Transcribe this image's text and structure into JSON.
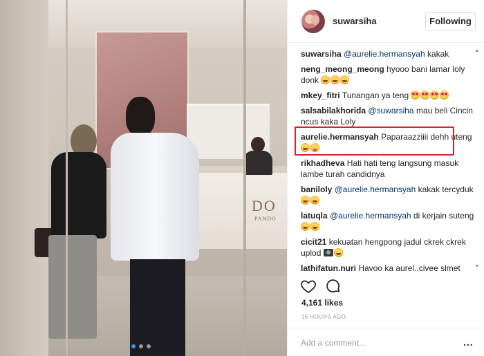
{
  "post": {
    "username": "suwarsiha",
    "follow_label": "Following",
    "likes": "4,161 likes",
    "timestamp": "16 HOURS AGO",
    "add_comment_placeholder": "Add a comment...",
    "more_label": "...",
    "carousel": {
      "count": 3,
      "active": 1
    },
    "store_sign": "DO",
    "store_sign_small": "PANDO"
  },
  "comments": [
    {
      "user": "suwarsiha",
      "mention": "@aurelie.hermansyah",
      "text": " kakak",
      "emoji": []
    },
    {
      "user": "neng_meong_meong",
      "mention": "",
      "text": " hyooo bani lamar loly donk ",
      "emoji": [
        "grin",
        "grin",
        "grin"
      ]
    },
    {
      "user": "mkey_fitri",
      "mention": "",
      "text": " Tunangan ya teng ",
      "emoji": [
        "heart-eyes",
        "heart-eyes",
        "heart-eyes",
        "heart-eyes"
      ]
    },
    {
      "user": "salsabilakhorida",
      "mention": "@suwarsiha",
      "text": " mau beli Cincin ncus kaka Loly",
      "emoji": []
    },
    {
      "user": "aurelie.hermansyah",
      "mention": "",
      "text": " Paparaazziiii dehh uteng",
      "emoji": [
        "grin",
        "tongue"
      ]
    },
    {
      "user": "rikhadheva",
      "mention": "",
      "text": " Hati hati teng langsung masuk lambe turah candidnya",
      "emoji": []
    },
    {
      "user": "baniloly",
      "mention": "@aurelie.hermansyah",
      "text": " kakak tercyduk ",
      "emoji": [
        "grin",
        "grin"
      ]
    },
    {
      "user": "latuqla",
      "mention": "@aurelie.hermansyah",
      "text": " di kerjain suteng ",
      "emoji": [
        "grin",
        "grin"
      ]
    },
    {
      "user": "cicit21",
      "mention": "",
      "text": " kekuatan hengpong jadul ckrek ckrek uplod ",
      "emoji": [
        "camera",
        "grin"
      ]
    },
    {
      "user": "lathifatun.nuri",
      "mention": "",
      "text": " Hayoo ka aurel..ciyee slmet",
      "emoji": []
    }
  ],
  "icons": {
    "like": "heart-outline-icon",
    "comment": "speech-bubble-icon",
    "scroll_up": "scroll-up-arrow-icon",
    "scroll_down": "scroll-down-arrow-icon"
  },
  "colors": {
    "highlight": "#d8232a",
    "mention": "#003569",
    "carousel_active": "#3897f0"
  }
}
